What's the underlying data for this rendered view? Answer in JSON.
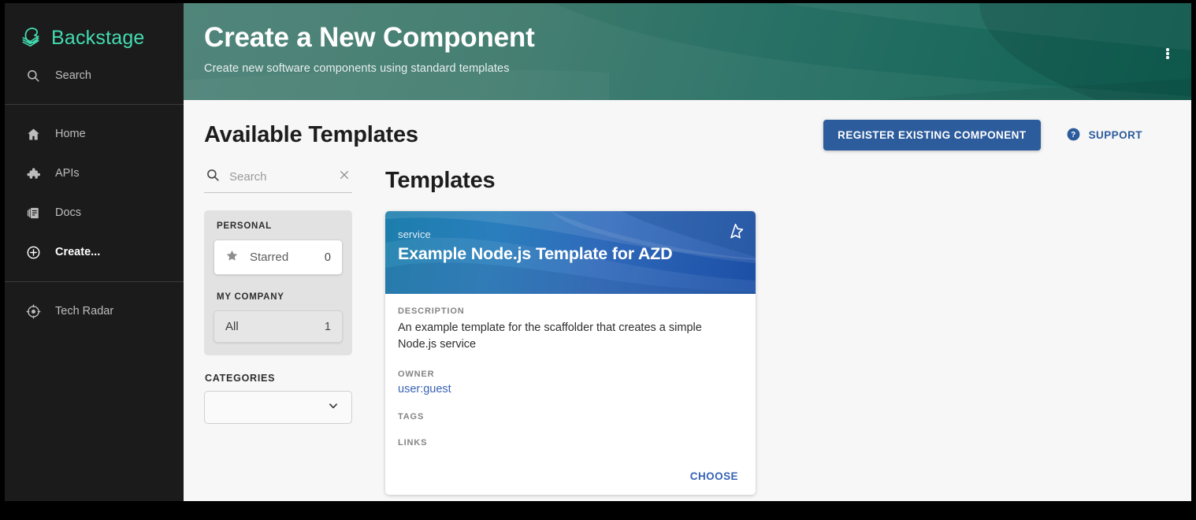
{
  "sidebar": {
    "brand": {
      "label": "Backstage",
      "icon": "backstage-logo-icon",
      "color": "#43dbb0"
    },
    "search": {
      "label": "Search",
      "icon": "search-icon"
    },
    "items": [
      {
        "label": "Home",
        "icon": "home-icon",
        "strong": false
      },
      {
        "label": "APIs",
        "icon": "puzzle-icon",
        "strong": false
      },
      {
        "label": "Docs",
        "icon": "docs-icon",
        "strong": false
      },
      {
        "label": "Create...",
        "icon": "plus-circle-icon",
        "strong": true
      },
      {
        "label": "Tech Radar",
        "icon": "radar-icon",
        "strong": false
      }
    ]
  },
  "header": {
    "title": "Create a New Component",
    "subtitle": "Create new software components using standard templates",
    "menu_icon": "kebab-menu-icon",
    "gradient_from": "#4a8075",
    "gradient_to": "#0f6254"
  },
  "toolbar": {
    "page_title": "Available Templates",
    "register_label": "REGISTER EXISTING COMPONENT",
    "support_label": "SUPPORT",
    "support_icon": "help-circle-icon",
    "accent_color": "#2c5c9c"
  },
  "filters": {
    "search": {
      "placeholder": "Search",
      "value": "",
      "icon": "search-icon",
      "clear_icon": "close-icon"
    },
    "groups": [
      {
        "label": "PERSONAL",
        "options": [
          {
            "label": "Starred",
            "count": "0",
            "icon": "star-filled-icon",
            "selected": false
          }
        ]
      },
      {
        "label": "MY COMPANY",
        "options": [
          {
            "label": "All",
            "count": "1",
            "icon": "",
            "selected": true
          }
        ]
      }
    ],
    "categories": {
      "label": "CATEGORIES",
      "value": "",
      "chevron_icon": "chevron-down-icon"
    }
  },
  "templates": {
    "section_title": "Templates",
    "cards": [
      {
        "kind": "service",
        "name": "Example Node.js Template for AZD",
        "favorite_icon": "star-outline-icon",
        "fields": {
          "description_label": "DESCRIPTION",
          "description_value": "An example template for the scaffolder that creates a simple Node.js service",
          "owner_label": "OWNER",
          "owner_value": "user:guest",
          "tags_label": "TAGS",
          "tags_value": "",
          "links_label": "LINKS",
          "links_value": ""
        },
        "choose_label": "CHOOSE",
        "header_gradient_from": "#1c7eac",
        "header_gradient_to": "#1b4fa6"
      }
    ]
  }
}
